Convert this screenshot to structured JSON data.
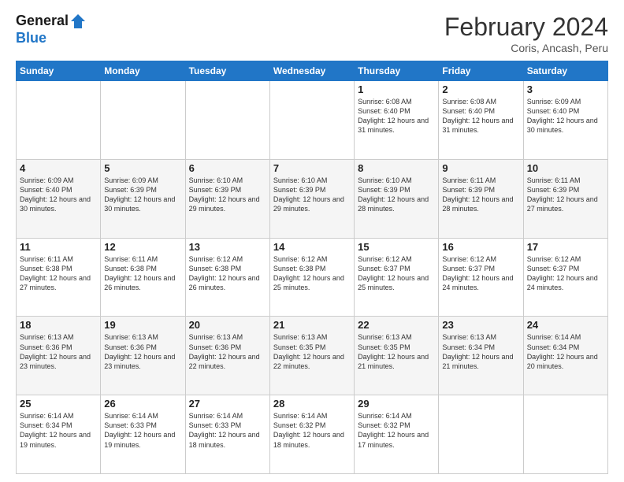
{
  "header": {
    "logo_line1": "General",
    "logo_line2": "Blue",
    "title": "February 2024",
    "subtitle": "Coris, Ancash, Peru"
  },
  "days_of_week": [
    "Sunday",
    "Monday",
    "Tuesday",
    "Wednesday",
    "Thursday",
    "Friday",
    "Saturday"
  ],
  "weeks": [
    [
      {
        "day": "",
        "info": ""
      },
      {
        "day": "",
        "info": ""
      },
      {
        "day": "",
        "info": ""
      },
      {
        "day": "",
        "info": ""
      },
      {
        "day": "1",
        "info": "Sunrise: 6:08 AM\nSunset: 6:40 PM\nDaylight: 12 hours and 31 minutes."
      },
      {
        "day": "2",
        "info": "Sunrise: 6:08 AM\nSunset: 6:40 PM\nDaylight: 12 hours and 31 minutes."
      },
      {
        "day": "3",
        "info": "Sunrise: 6:09 AM\nSunset: 6:40 PM\nDaylight: 12 hours and 30 minutes."
      }
    ],
    [
      {
        "day": "4",
        "info": "Sunrise: 6:09 AM\nSunset: 6:40 PM\nDaylight: 12 hours and 30 minutes."
      },
      {
        "day": "5",
        "info": "Sunrise: 6:09 AM\nSunset: 6:39 PM\nDaylight: 12 hours and 30 minutes."
      },
      {
        "day": "6",
        "info": "Sunrise: 6:10 AM\nSunset: 6:39 PM\nDaylight: 12 hours and 29 minutes."
      },
      {
        "day": "7",
        "info": "Sunrise: 6:10 AM\nSunset: 6:39 PM\nDaylight: 12 hours and 29 minutes."
      },
      {
        "day": "8",
        "info": "Sunrise: 6:10 AM\nSunset: 6:39 PM\nDaylight: 12 hours and 28 minutes."
      },
      {
        "day": "9",
        "info": "Sunrise: 6:11 AM\nSunset: 6:39 PM\nDaylight: 12 hours and 28 minutes."
      },
      {
        "day": "10",
        "info": "Sunrise: 6:11 AM\nSunset: 6:39 PM\nDaylight: 12 hours and 27 minutes."
      }
    ],
    [
      {
        "day": "11",
        "info": "Sunrise: 6:11 AM\nSunset: 6:38 PM\nDaylight: 12 hours and 27 minutes."
      },
      {
        "day": "12",
        "info": "Sunrise: 6:11 AM\nSunset: 6:38 PM\nDaylight: 12 hours and 26 minutes."
      },
      {
        "day": "13",
        "info": "Sunrise: 6:12 AM\nSunset: 6:38 PM\nDaylight: 12 hours and 26 minutes."
      },
      {
        "day": "14",
        "info": "Sunrise: 6:12 AM\nSunset: 6:38 PM\nDaylight: 12 hours and 25 minutes."
      },
      {
        "day": "15",
        "info": "Sunrise: 6:12 AM\nSunset: 6:37 PM\nDaylight: 12 hours and 25 minutes."
      },
      {
        "day": "16",
        "info": "Sunrise: 6:12 AM\nSunset: 6:37 PM\nDaylight: 12 hours and 24 minutes."
      },
      {
        "day": "17",
        "info": "Sunrise: 6:12 AM\nSunset: 6:37 PM\nDaylight: 12 hours and 24 minutes."
      }
    ],
    [
      {
        "day": "18",
        "info": "Sunrise: 6:13 AM\nSunset: 6:36 PM\nDaylight: 12 hours and 23 minutes."
      },
      {
        "day": "19",
        "info": "Sunrise: 6:13 AM\nSunset: 6:36 PM\nDaylight: 12 hours and 23 minutes."
      },
      {
        "day": "20",
        "info": "Sunrise: 6:13 AM\nSunset: 6:36 PM\nDaylight: 12 hours and 22 minutes."
      },
      {
        "day": "21",
        "info": "Sunrise: 6:13 AM\nSunset: 6:35 PM\nDaylight: 12 hours and 22 minutes."
      },
      {
        "day": "22",
        "info": "Sunrise: 6:13 AM\nSunset: 6:35 PM\nDaylight: 12 hours and 21 minutes."
      },
      {
        "day": "23",
        "info": "Sunrise: 6:13 AM\nSunset: 6:34 PM\nDaylight: 12 hours and 21 minutes."
      },
      {
        "day": "24",
        "info": "Sunrise: 6:14 AM\nSunset: 6:34 PM\nDaylight: 12 hours and 20 minutes."
      }
    ],
    [
      {
        "day": "25",
        "info": "Sunrise: 6:14 AM\nSunset: 6:34 PM\nDaylight: 12 hours and 19 minutes."
      },
      {
        "day": "26",
        "info": "Sunrise: 6:14 AM\nSunset: 6:33 PM\nDaylight: 12 hours and 19 minutes."
      },
      {
        "day": "27",
        "info": "Sunrise: 6:14 AM\nSunset: 6:33 PM\nDaylight: 12 hours and 18 minutes."
      },
      {
        "day": "28",
        "info": "Sunrise: 6:14 AM\nSunset: 6:32 PM\nDaylight: 12 hours and 18 minutes."
      },
      {
        "day": "29",
        "info": "Sunrise: 6:14 AM\nSunset: 6:32 PM\nDaylight: 12 hours and 17 minutes."
      },
      {
        "day": "",
        "info": ""
      },
      {
        "day": "",
        "info": ""
      }
    ]
  ]
}
